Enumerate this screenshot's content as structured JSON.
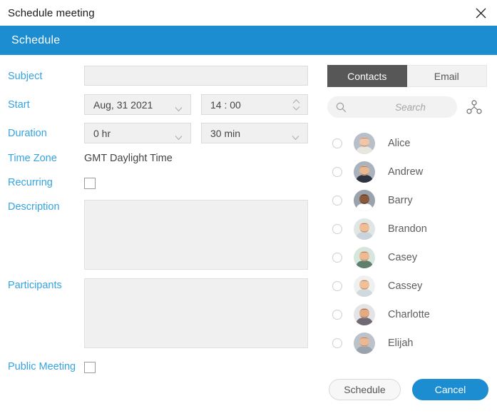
{
  "window": {
    "title": "Schedule meeting",
    "close_icon": "close-icon"
  },
  "header": {
    "title": "Schedule",
    "accent_color": "#1b8dd0"
  },
  "form": {
    "labels": {
      "subject": "Subject",
      "start": "Start",
      "duration": "Duration",
      "time_zone": "Time Zone",
      "recurring": "Recurring",
      "description": "Description",
      "participants": "Participants",
      "public_meeting": "Public Meeting"
    },
    "subject": {
      "value": "",
      "placeholder": ""
    },
    "start": {
      "date": "Aug, 31 2021",
      "time": "14 :  00"
    },
    "duration": {
      "hours": "0   hr",
      "minutes": "30   min"
    },
    "time_zone_value": "GMT Daylight Time",
    "recurring_checked": false,
    "description": {
      "value": "",
      "placeholder": ""
    },
    "participants": {
      "value": "",
      "placeholder": ""
    },
    "public_meeting_checked": false,
    "label_color": "#35a3e0"
  },
  "people_panel": {
    "tabs": [
      {
        "label": "Contacts",
        "active": true
      },
      {
        "label": "Email",
        "active": false
      }
    ],
    "search": {
      "value": "",
      "placeholder": "Search",
      "icon": "search-icon"
    },
    "network_icon": "network-share-icon",
    "contacts": [
      {
        "name": "Alice",
        "selected": false,
        "avatar": "photo-woman-phone"
      },
      {
        "name": "Andrew",
        "selected": false,
        "avatar": "photo-man-phone"
      },
      {
        "name": "Barry",
        "selected": false,
        "avatar": "photo-man-suit-phone"
      },
      {
        "name": "Brandon",
        "selected": false,
        "avatar": "photo-man-beard"
      },
      {
        "name": "Casey",
        "selected": false,
        "avatar": "photo-man-beard-green"
      },
      {
        "name": "Cassey",
        "selected": false,
        "avatar": "photo-man-smiling"
      },
      {
        "name": "Charlotte",
        "selected": false,
        "avatar": "photo-woman-glasses"
      },
      {
        "name": "Elijah",
        "selected": false,
        "avatar": "photo-man-phone-gray"
      }
    ]
  },
  "footer": {
    "schedule_label": "Schedule",
    "cancel_label": "Cancel",
    "cancel_color": "#1b8dd0"
  }
}
